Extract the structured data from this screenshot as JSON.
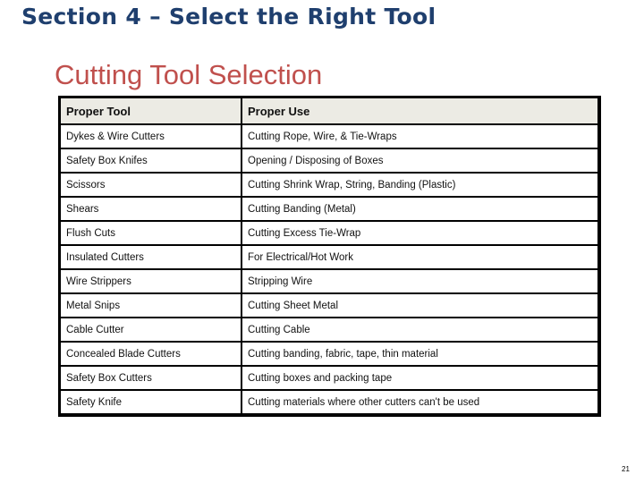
{
  "section_title": "Section 4 – Select the Right Tool",
  "slide_title": "Cutting Tool Selection",
  "table": {
    "headers": [
      "Proper Tool",
      "Proper Use"
    ],
    "rows": [
      [
        "Dykes & Wire Cutters",
        "Cutting Rope, Wire, & Tie-Wraps"
      ],
      [
        "Safety Box Knifes",
        "Opening / Disposing of Boxes"
      ],
      [
        "Scissors",
        "Cutting Shrink Wrap, String, Banding (Plastic)"
      ],
      [
        "Shears",
        "Cutting Banding (Metal)"
      ],
      [
        "Flush Cuts",
        "Cutting Excess Tie-Wrap"
      ],
      [
        "Insulated Cutters",
        "For Electrical/Hot Work"
      ],
      [
        "Wire Strippers",
        "Stripping Wire"
      ],
      [
        "Metal Snips",
        "Cutting Sheet Metal"
      ],
      [
        "Cable Cutter",
        "Cutting Cable"
      ],
      [
        "Concealed Blade Cutters",
        "Cutting banding, fabric, tape, thin material"
      ],
      [
        "Safety Box Cutters",
        "Cutting boxes and packing tape"
      ],
      [
        "Safety Knife",
        "Cutting materials where other cutters can't be used"
      ]
    ]
  },
  "page_number": "21",
  "colors": {
    "section_title": "#1f3f6e",
    "slide_title": "#c0504d",
    "header_bg": "#ecebe4"
  }
}
